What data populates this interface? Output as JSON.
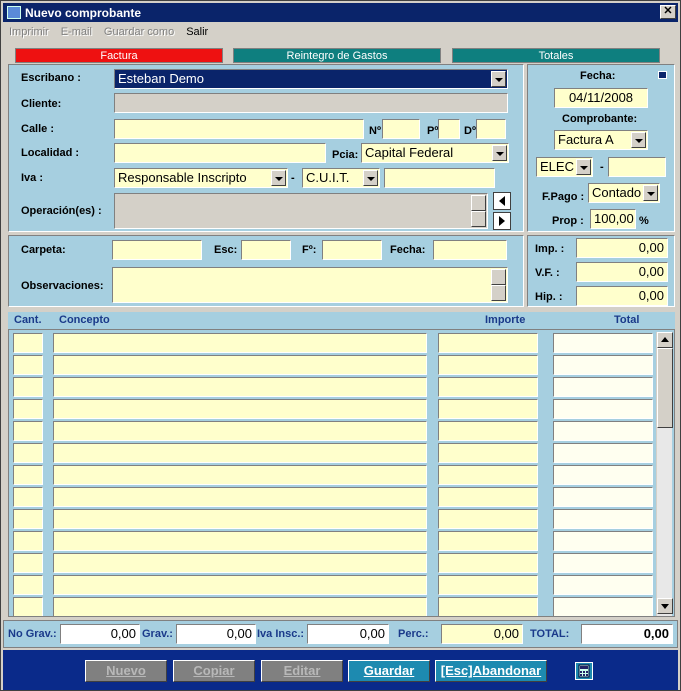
{
  "window": {
    "title": "Nuevo comprobante",
    "close": "✕"
  },
  "menu": [
    "Imprimir",
    "E-mail",
    "Guardar como",
    "Salir"
  ],
  "tabs": {
    "factura": "Factura",
    "reintegro": "Reintegro de Gastos",
    "totales": "Totales"
  },
  "form": {
    "escribano_label": "Escribano :",
    "escribano_value": "Esteban Demo",
    "cliente_label": "Cliente:",
    "calle_label": "Calle :",
    "nro_label": "Nº",
    "piso_label": "Pº",
    "depto_label": "Dº",
    "localidad_label": "Localidad :",
    "pcia_label": "Pcia:",
    "pcia_value": "Capital Federal",
    "iva_label": "Iva :",
    "iva_value": "Responsable Inscripto",
    "dash": "-",
    "doc_type": "C.U.I.T.",
    "operaciones_label": "Operación(es) :"
  },
  "side": {
    "fecha_label": "Fecha:",
    "fecha_value": "04/11/2008",
    "comprobante_label": "Comprobante:",
    "comprobante_value": "Factura A",
    "elec_value": "ELEC",
    "dash": "-",
    "fpago_label": "F.Pago :",
    "fpago_value": "Contado",
    "prop_label": "Prop :",
    "prop_value": "100,00",
    "prop_unit": "%"
  },
  "section2": {
    "carpeta_label": "Carpeta:",
    "esc_label": "Esc:",
    "folio_label": "Fº:",
    "fecha_label": "Fecha:",
    "observaciones_label": "Observaciones:"
  },
  "side2": {
    "imp_label": "Imp. :",
    "imp_value": "0,00",
    "vf_label": "V.F. :",
    "vf_value": "0,00",
    "hip_label": "Hip. :",
    "hip_value": "0,00"
  },
  "grid": {
    "cant": "Cant.",
    "concepto": "Concepto",
    "importe": "Importe",
    "total": "Total"
  },
  "totals": {
    "nograv_label": "No Grav.:",
    "nograv_value": "0,00",
    "grav_label": "Grav.:",
    "grav_value": "0,00",
    "ivainsc_label": "Iva Insc.:",
    "ivainsc_value": "0,00",
    "perc_label": "Perc.:",
    "perc_value": "0,00",
    "total_label": "TOTAL:",
    "total_value": "0,00"
  },
  "footer": {
    "nuevo": "Nuevo",
    "copiar": "Copiar",
    "editar": "Editar",
    "guardar": "Guardar",
    "abandonar": "[Esc]Abandonar"
  },
  "colors": {
    "titlebar": "#0a246a",
    "panel": "#a6cfe0",
    "field": "#ffffcc",
    "tab_active": "#ee1111",
    "tab_inactive": "#0e7f7f",
    "footer": "#0a2a8a"
  }
}
